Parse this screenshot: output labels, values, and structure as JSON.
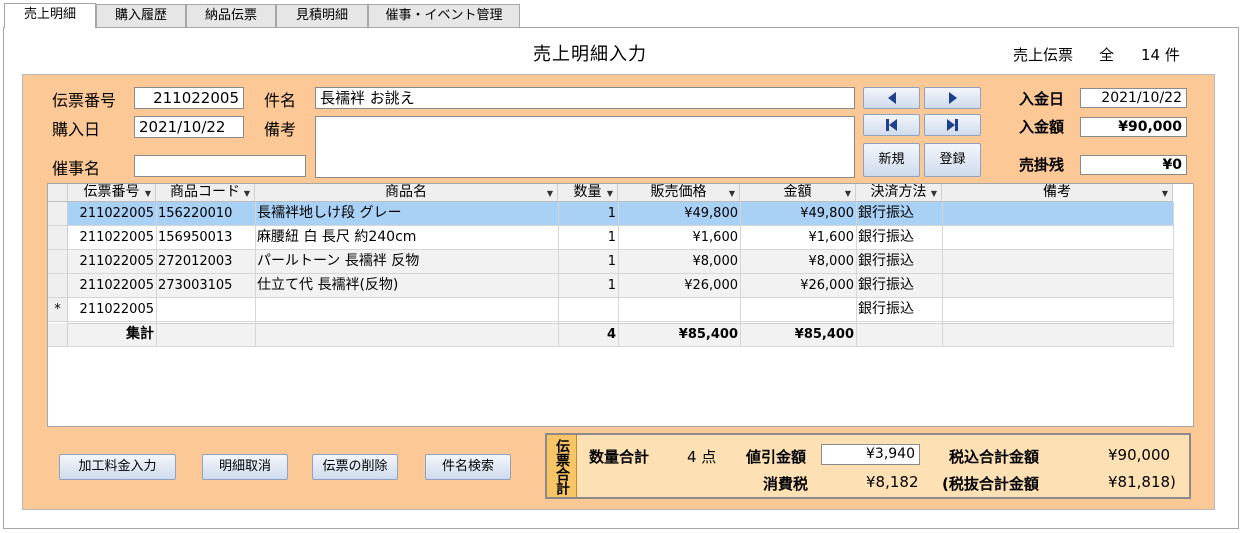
{
  "tabs": [
    "売上明細",
    "購入履歴",
    "納品伝票",
    "見積明細",
    "催事・イベント管理"
  ],
  "page_title": "売上明細入力",
  "record_info": {
    "label": "売上伝票",
    "scope": "全",
    "count": "14 件"
  },
  "form": {
    "slip_no_label": "伝票番号",
    "slip_no": "211022005",
    "subject_label": "件名",
    "subject": "長襦袢 お誂え",
    "purchase_date_label": "購入日",
    "purchase_date": "2021/10/22",
    "remarks_label": "備考",
    "remarks": "",
    "event_label": "催事名",
    "event": ""
  },
  "buttons": {
    "new": "新規",
    "register": "登録"
  },
  "payment": {
    "deposit_date_label": "入金日",
    "deposit_date": "2021/10/22",
    "deposit_amount_label": "入金額",
    "deposit_amount": "¥90,000",
    "receivable_label": "売掛残",
    "receivable": "¥0"
  },
  "grid": {
    "columns": [
      "伝票番号",
      "商品コード",
      "商品名",
      "数量",
      "販売価格",
      "金額",
      "決済方法",
      "備考"
    ],
    "rows": [
      {
        "slip": "211022005",
        "code": "156220010",
        "name": "長襦袢地しけ段 グレー",
        "qty": "1",
        "price": "¥49,800",
        "amount": "¥49,800",
        "method": "銀行振込",
        "note": ""
      },
      {
        "slip": "211022005",
        "code": "156950013",
        "name": "麻腰紐 白 長尺 約240cm",
        "qty": "1",
        "price": "¥1,600",
        "amount": "¥1,600",
        "method": "銀行振込",
        "note": ""
      },
      {
        "slip": "211022005",
        "code": "272012003",
        "name": "パールトーン 長襦袢 反物",
        "qty": "1",
        "price": "¥8,000",
        "amount": "¥8,000",
        "method": "銀行振込",
        "note": ""
      },
      {
        "slip": "211022005",
        "code": "273003105",
        "name": "仕立て代 長襦袢(反物)",
        "qty": "1",
        "price": "¥26,000",
        "amount": "¥26,000",
        "method": "銀行振込",
        "note": ""
      }
    ],
    "new_row": {
      "marker": "*",
      "slip": "211022005",
      "method": "銀行振込"
    },
    "total": {
      "label": "集計",
      "qty": "4",
      "price": "¥85,400",
      "amount": "¥85,400"
    }
  },
  "actions": [
    "加工料金入力",
    "明細取消",
    "伝票の削除",
    "件名検索"
  ],
  "totals": {
    "tag": "伝票合計",
    "qty_label": "数量合計",
    "qty": "4 点",
    "discount_label": "値引金額",
    "discount": "¥3,940",
    "tax_included_label": "税込合計金額",
    "tax_included": "¥90,000",
    "tax_label": "消費税",
    "tax": "¥8,182",
    "tax_excluded_label": "(税抜合計金額",
    "tax_excluded": "¥81,818)"
  }
}
